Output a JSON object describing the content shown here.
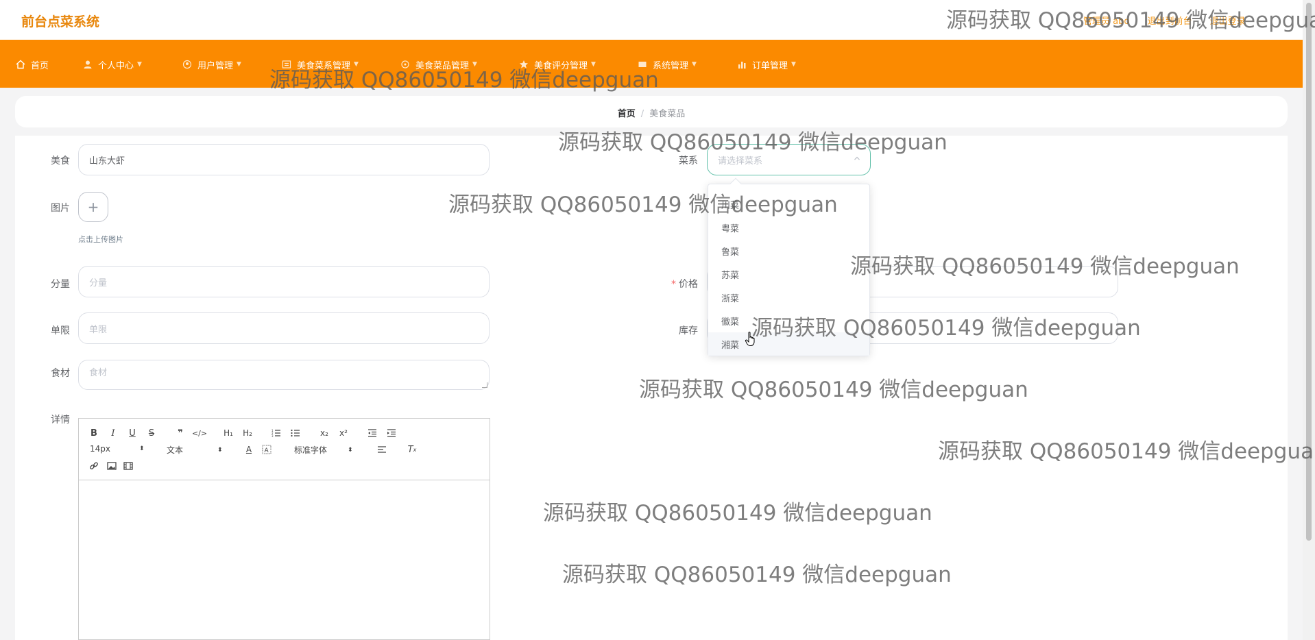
{
  "app": {
    "title": "前台点菜系统"
  },
  "top_links": {
    "user": "管理员 abo",
    "exit_admin": "退出到前台",
    "logout": "退出登录"
  },
  "nav": {
    "items": [
      {
        "label": "首页",
        "icon": "home-icon",
        "has_caret": false
      },
      {
        "label": "个人中心",
        "icon": "user-icon",
        "has_caret": true
      },
      {
        "label": "用户管理",
        "icon": "users-icon",
        "has_caret": true
      },
      {
        "label": "美食菜系管理",
        "icon": "menu-icon",
        "has_caret": true
      },
      {
        "label": "美食菜品管理",
        "icon": "dish-icon",
        "has_caret": true
      },
      {
        "label": "美食评分管理",
        "icon": "star-icon",
        "has_caret": true
      },
      {
        "label": "系统管理",
        "icon": "settings-icon",
        "has_caret": true
      },
      {
        "label": "订单管理",
        "icon": "chart-icon",
        "has_caret": true
      }
    ]
  },
  "breadcrumb": {
    "home": "首页",
    "separator": "/",
    "current": "美食菜品"
  },
  "form": {
    "food_label": "美食",
    "food_value": "山东大虾",
    "cuisine_label": "菜系",
    "cuisine_placeholder": "请选择菜系",
    "image_label": "图片",
    "upload_plus": "+",
    "upload_tip": "点击上传图片",
    "portion_label": "分量",
    "portion_placeholder": "分量",
    "price_label": "价格",
    "price_required": "*",
    "limit_label": "单限",
    "limit_placeholder": "单限",
    "stock_label": "库存",
    "ingredients_label": "食材",
    "ingredients_placeholder": "食材",
    "detail_label": "详情"
  },
  "editor": {
    "font_size": "14px",
    "text_type": "文本",
    "font_family": "标准字体",
    "buttons": [
      "B",
      "I",
      "U",
      "S",
      "❞",
      "</>",
      "H1",
      "H2",
      "ol",
      "ul",
      "x₂",
      "x²",
      "outdent",
      "indent",
      "A",
      "A-bg",
      "align",
      "Tx",
      "link",
      "image",
      "video"
    ]
  },
  "dropdown": {
    "options": [
      "川菜",
      "粤菜",
      "鲁菜",
      "苏菜",
      "浙菜",
      "徽菜",
      "湘菜"
    ],
    "hovered_index": 6
  },
  "watermark": {
    "text": "源码获取 QQ86050149 微信deepguan"
  },
  "colors": {
    "accent": "#fb8a00",
    "title": "#e8870d",
    "focus": "#5fbfa8"
  }
}
